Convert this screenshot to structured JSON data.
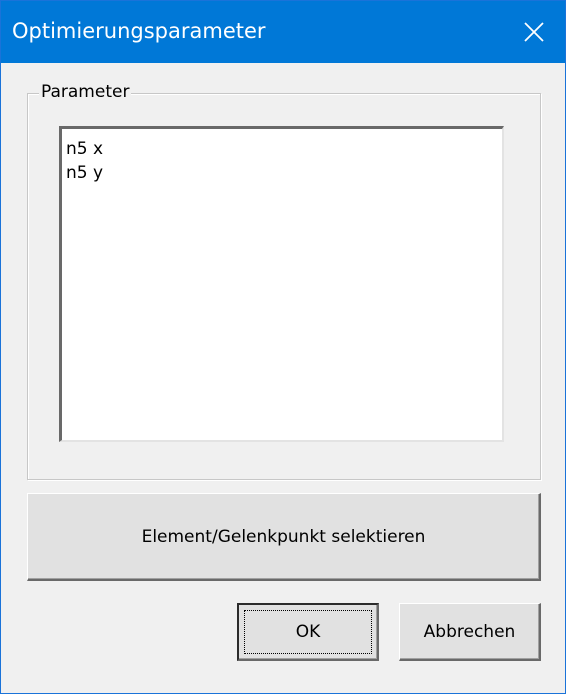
{
  "window": {
    "title": "Optimierungsparameter",
    "accent_color": "#0078d7",
    "close_icon": "close-icon"
  },
  "group": {
    "label": "Parameter",
    "items": [
      "n5 x",
      "n5 y"
    ]
  },
  "buttons": {
    "select_label": "Element/Gelenkpunkt selektieren",
    "ok_label": "OK",
    "cancel_label": "Abbrechen"
  }
}
